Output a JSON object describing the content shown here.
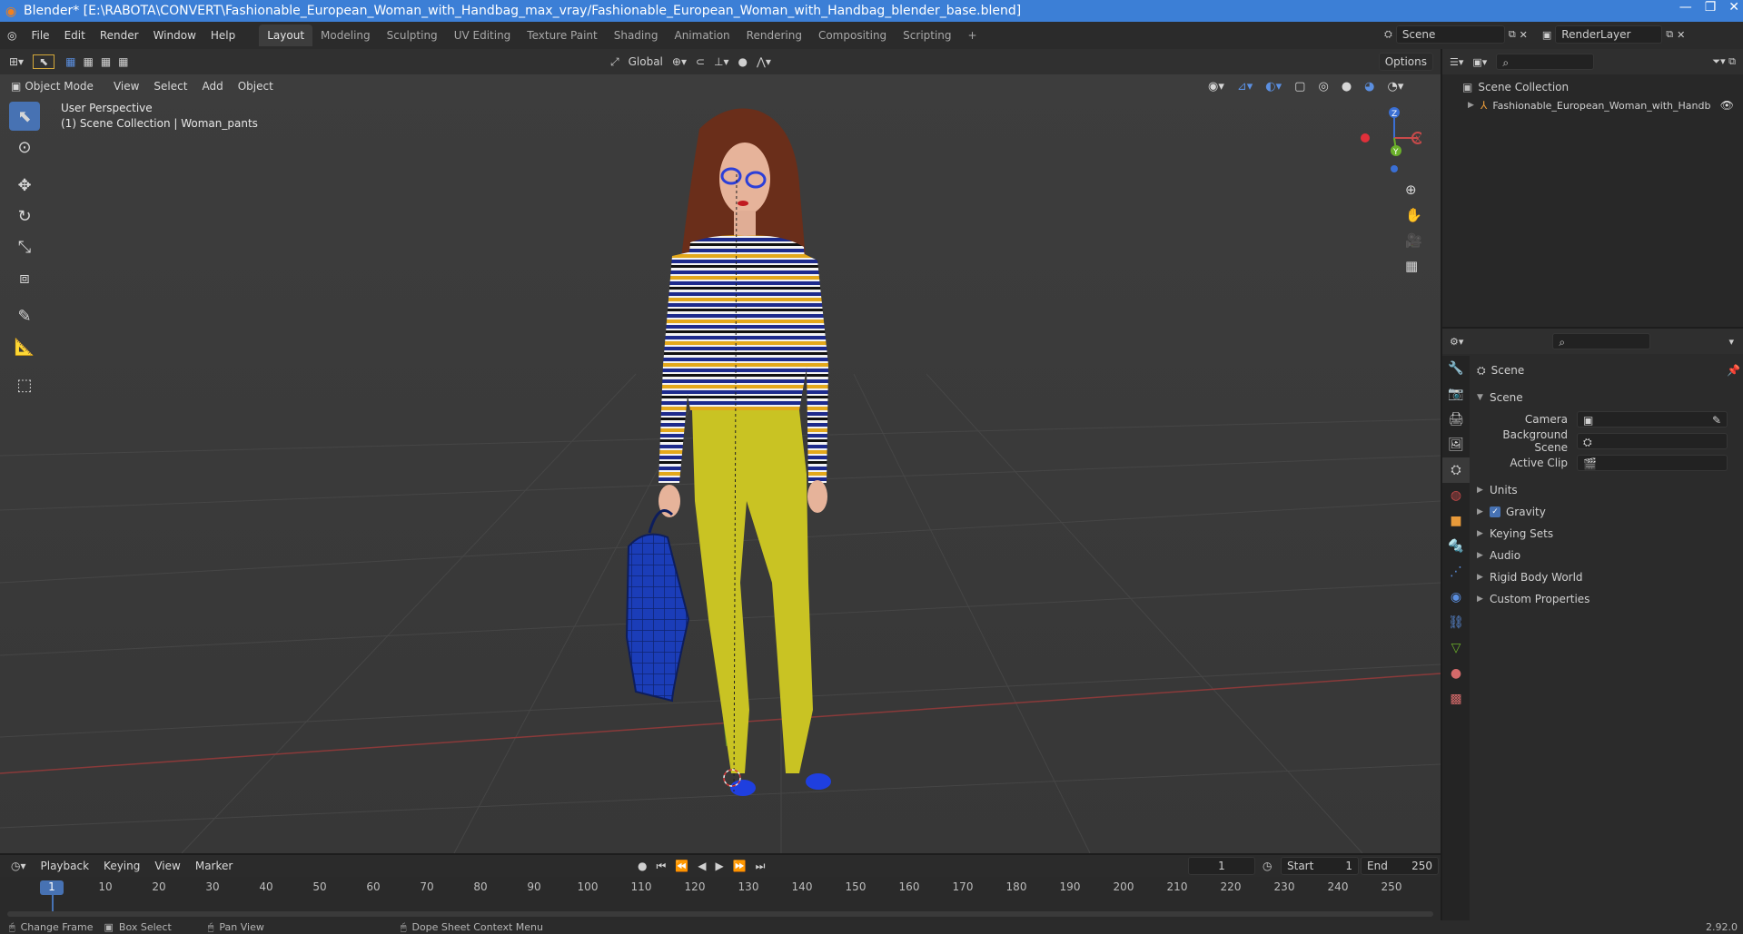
{
  "window": {
    "title": "Blender* [E:\\RABOTA\\CONVERT\\Fashionable_European_Woman_with_Handbag_max_vray/Fashionable_European_Woman_with_Handbag_blender_base.blend]"
  },
  "menu": {
    "file": "File",
    "edit": "Edit",
    "render": "Render",
    "window": "Window",
    "help": "Help"
  },
  "workspaces": [
    "Layout",
    "Modeling",
    "Sculpting",
    "UV Editing",
    "Texture Paint",
    "Shading",
    "Animation",
    "Rendering",
    "Compositing",
    "Scripting"
  ],
  "scene_field": "Scene",
  "renderlayer_field": "RenderLayer",
  "viewport": {
    "transform_orientation": "Global",
    "options_label": "Options",
    "mode": "Object Mode",
    "view": "View",
    "select": "Select",
    "add": "Add",
    "object": "Object",
    "perspective_label": "User Perspective",
    "collection_label": "(1) Scene Collection | Woman_pants",
    "gizmo_axes": {
      "x": "X",
      "y": "Y",
      "z": "Z"
    }
  },
  "outliner": {
    "scene_collection": "Scene Collection",
    "object": "Fashionable_European_Woman_with_Handb"
  },
  "properties": {
    "header": "Scene",
    "panel_scene": "Scene",
    "camera_label": "Camera",
    "background_scene_label": "Background Scene",
    "active_clip_label": "Active Clip",
    "panels": [
      "Units",
      "Gravity",
      "Keying Sets",
      "Audio",
      "Rigid Body World",
      "Custom Properties"
    ]
  },
  "timeline": {
    "playback": "Playback",
    "keying": "Keying",
    "view": "View",
    "marker": "Marker",
    "current_frame": "1",
    "start_label": "Start",
    "start_value": "1",
    "end_label": "End",
    "end_value": "250",
    "ruler_current": "1",
    "ruler_ticks": [
      "10",
      "20",
      "30",
      "40",
      "50",
      "60",
      "70",
      "80",
      "90",
      "100",
      "110",
      "120",
      "130",
      "140",
      "150",
      "160",
      "170",
      "180",
      "190",
      "200",
      "210",
      "220",
      "230",
      "240",
      "250"
    ]
  },
  "statusbar": {
    "change_frame": "Change Frame",
    "box_select": "Box Select",
    "pan_view": "Pan View",
    "context_menu": "Dope Sheet Context Menu",
    "version": "2.92.0"
  },
  "colors": {
    "accent": "#4772b3",
    "titlebar": "#3c7fd6",
    "viewport_bg": "#3c3c3c",
    "pants": "#c8c422",
    "bag": "#1b3db8"
  }
}
